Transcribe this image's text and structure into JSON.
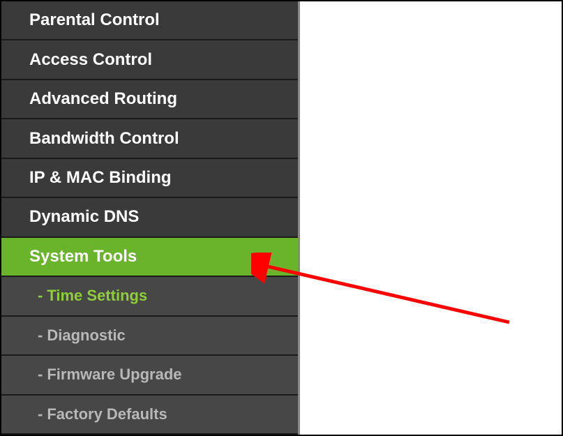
{
  "sidebar": {
    "items": [
      {
        "label": "Parental Control",
        "type": "main",
        "active": false
      },
      {
        "label": "Access Control",
        "type": "main",
        "active": false
      },
      {
        "label": "Advanced Routing",
        "type": "main",
        "active": false
      },
      {
        "label": "Bandwidth Control",
        "type": "main",
        "active": false
      },
      {
        "label": "IP & MAC Binding",
        "type": "main",
        "active": false
      },
      {
        "label": "Dynamic DNS",
        "type": "main",
        "active": false
      },
      {
        "label": "System Tools",
        "type": "main",
        "active": true
      },
      {
        "label": "Time Settings",
        "type": "sub",
        "highlighted": true,
        "prefix": "-"
      },
      {
        "label": "Diagnostic",
        "type": "sub",
        "highlighted": false,
        "prefix": "-"
      },
      {
        "label": "Firmware Upgrade",
        "type": "sub",
        "highlighted": false,
        "prefix": "-"
      },
      {
        "label": "Factory Defaults",
        "type": "sub",
        "highlighted": false,
        "prefix": "-"
      }
    ]
  },
  "annotation": {
    "arrow_color": "#ff0000"
  }
}
